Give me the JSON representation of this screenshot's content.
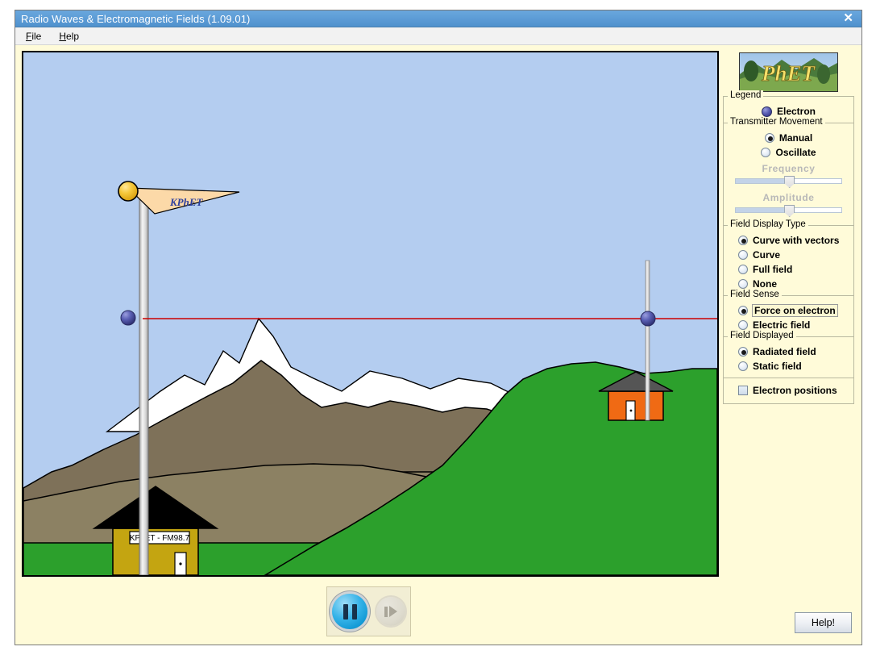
{
  "window": {
    "title": "Radio Waves & Electromagnetic Fields (1.09.01)",
    "close_icon": "close-icon",
    "titlebar_color": "#5b9bd5"
  },
  "menubar": {
    "items": [
      {
        "label": "File",
        "mnemonic": "F"
      },
      {
        "label": "Help",
        "mnemonic": "H"
      }
    ]
  },
  "simulation": {
    "background_sky": "#b4cdf0",
    "grass_color": "#2ca02c",
    "field_line_color": "#cc0000",
    "transmitter": {
      "flag_text": "KPhET",
      "station_sign": "KPhET - FM98.7",
      "station_color": "#c4a511",
      "roof_color": "#000000",
      "knob_color": "#f2c230",
      "electron_color": "#4b4f9e"
    },
    "receiver": {
      "house_color": "#f06a14",
      "roof_color": "#555555",
      "electron_color": "#4b4f9e"
    }
  },
  "clock_controls": {
    "pause_button": "pause-button",
    "step_button": "step-forward-button",
    "pause_enabled": true,
    "step_enabled": false
  },
  "logo": {
    "alt": "PhET",
    "text": "PhET"
  },
  "panels": {
    "legend": {
      "title": "Legend",
      "items": [
        {
          "label": "Electron",
          "icon": "electron-sphere-icon"
        }
      ]
    },
    "transmitter_movement": {
      "title": "Transmitter Movement",
      "options": [
        {
          "label": "Manual",
          "selected": true
        },
        {
          "label": "Oscillate",
          "selected": false
        }
      ],
      "sliders": [
        {
          "label": "Frequency",
          "value": 48,
          "enabled": false
        },
        {
          "label": "Amplitude",
          "value": 48,
          "enabled": false
        }
      ]
    },
    "field_display_type": {
      "title": "Field Display Type",
      "options": [
        {
          "label": "Curve with vectors",
          "selected": true
        },
        {
          "label": "Curve",
          "selected": false
        },
        {
          "label": "Full field",
          "selected": false
        },
        {
          "label": "None",
          "selected": false
        }
      ]
    },
    "field_sense": {
      "title": "Field Sense",
      "options": [
        {
          "label": "Force on electron",
          "selected": true,
          "focused": true
        },
        {
          "label": "Electric field",
          "selected": false
        }
      ]
    },
    "field_displayed": {
      "title": "Field Displayed",
      "options": [
        {
          "label": "Radiated field",
          "selected": true
        },
        {
          "label": "Static field",
          "selected": false
        }
      ]
    },
    "electron_positions": {
      "label": "Electron positions",
      "checked": false
    }
  },
  "buttons": {
    "help": "Help!"
  }
}
